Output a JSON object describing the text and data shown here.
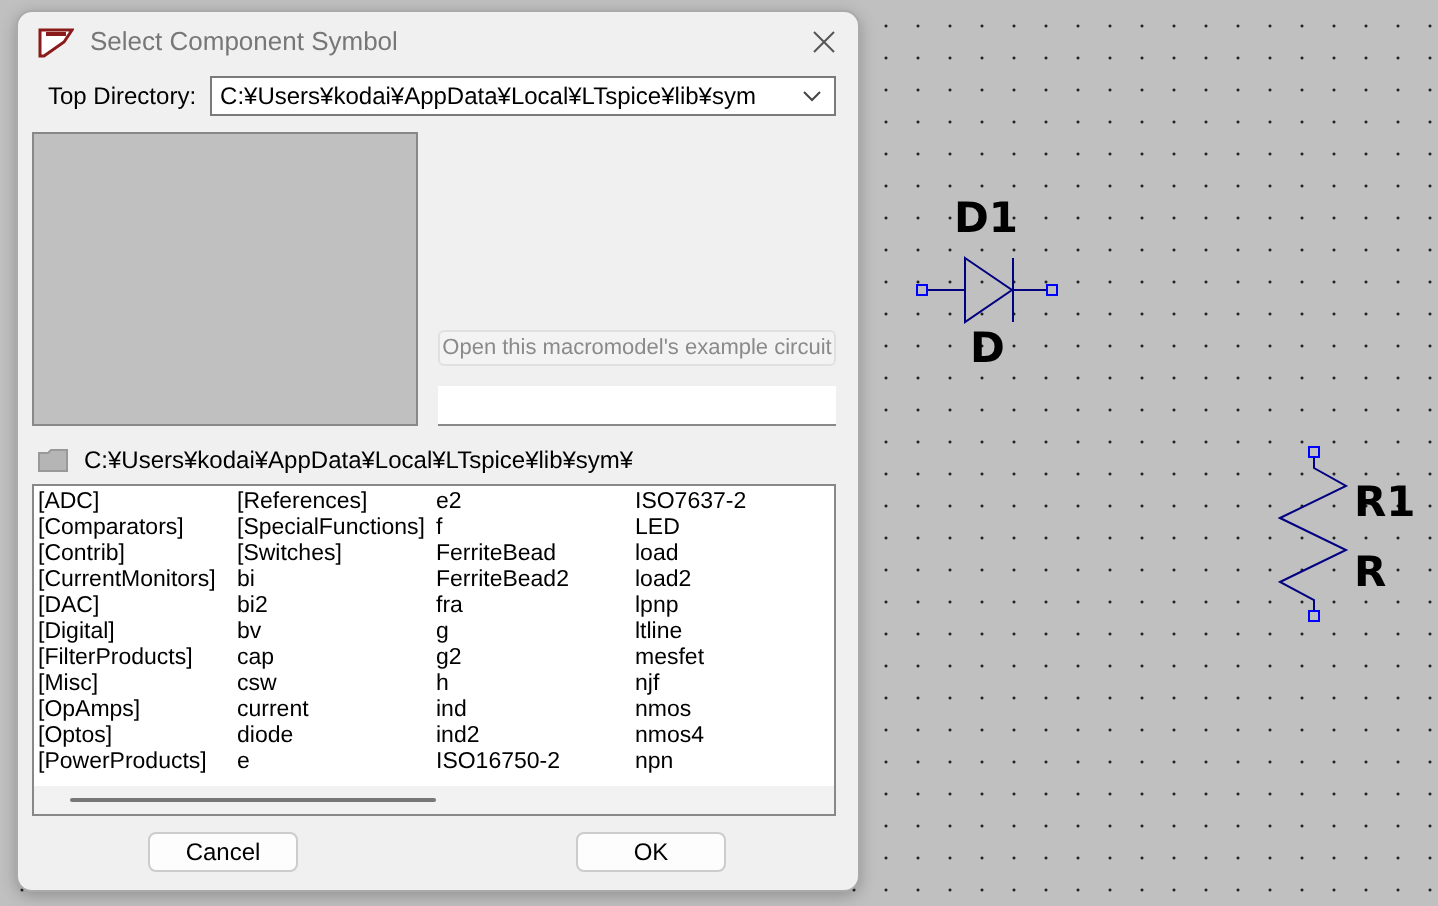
{
  "dialog": {
    "title": "Select Component Symbol",
    "top_directory": {
      "label": "Top Directory:",
      "value": "C:¥Users¥kodai¥AppData¥Local¥LTspice¥lib¥sym"
    },
    "example_button": {
      "label": "Open this macromodel's example circuit",
      "disabled": true
    },
    "current_path": "C:¥Users¥kodai¥AppData¥Local¥LTspice¥lib¥sym¥",
    "symbol_columns": [
      [
        "[ADC]",
        "[Comparators]",
        "[Contrib]",
        "[CurrentMonitors]",
        "[DAC]",
        "[Digital]",
        "[FilterProducts]",
        "[Misc]",
        "[OpAmps]",
        "[Optos]",
        "[PowerProducts]"
      ],
      [
        "[References]",
        "[SpecialFunctions]",
        "[Switches]",
        "bi",
        "bi2",
        "bv",
        "cap",
        "csw",
        "current",
        "diode",
        "e"
      ],
      [
        "e2",
        "f",
        "FerriteBead",
        "FerriteBead2",
        "fra",
        "g",
        "g2",
        "h",
        "ind",
        "ind2",
        "ISO16750-2"
      ],
      [
        "ISO7637-2",
        "LED",
        "load",
        "load2",
        "lpnp",
        "ltline",
        "mesfet",
        "njf",
        "nmos",
        "nmos4",
        "npn"
      ]
    ],
    "buttons": [
      {
        "label": "Cancel"
      },
      {
        "label": "OK"
      }
    ]
  },
  "schematic": {
    "components": [
      {
        "kind": "diode",
        "ref": "D1",
        "value": "D"
      },
      {
        "kind": "resistor",
        "ref": "R1",
        "value": "R"
      }
    ]
  }
}
